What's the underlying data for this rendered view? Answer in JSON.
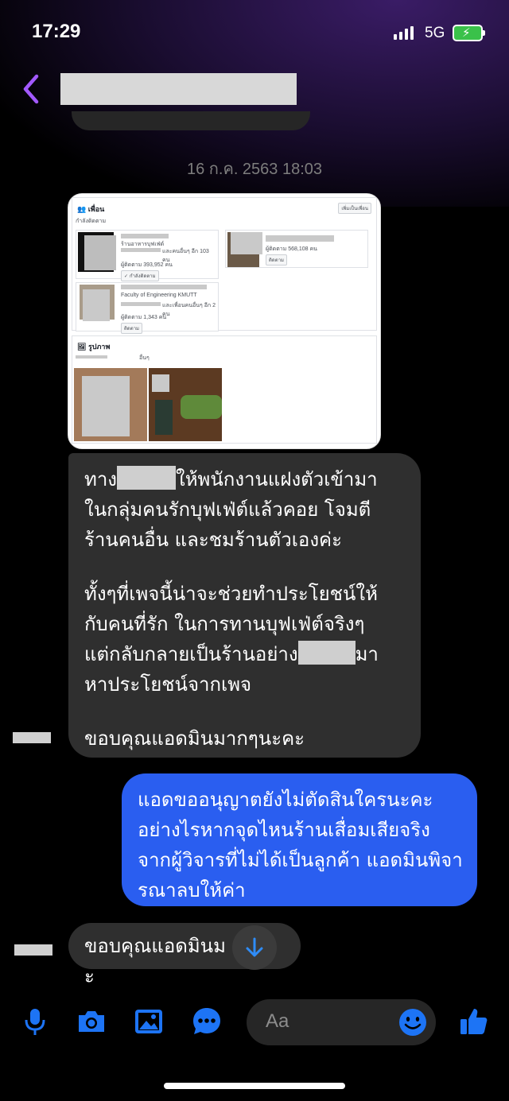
{
  "status_bar": {
    "time": "17:29",
    "network": "5G"
  },
  "header": {
    "contact_name": ""
  },
  "thread": {
    "timestamp": "16 ก.ค. 2563 18:03",
    "attachment": {
      "friends_title": "เพื่อน",
      "following_label": "กำลังติดตาม",
      "add_friend": "เพิ่มเป็นเพื่อน",
      "photos_title": "รูปภาพ",
      "follow_btn": "ติดตาม",
      "following_btn": "✓ กำลังติดตาม",
      "card2_line1": "Faculty of Engineering KMUTT",
      "card1_sub": "ร้านอาหารบุฟเฟ่ต์",
      "card1_mutual": "และคนอื่นๆ อีก 103 คน",
      "card1_followers": "ผู้ติดตาม 393,952 คน",
      "card3_followers": "ผู้ติดตาม 568,108 คน",
      "card2_mutual": "และเพื่อนคนอื่นๆ อีก 2 คน",
      "card2_followers": "ผู้ติดตาม 1,343 คน",
      "photos_other": "อื่นๆ"
    },
    "incoming_1": {
      "line1_a": "ทาง",
      "line1_b": "ให้พนักงานแฝงตัวเข้ามา",
      "line2": "ในกลุ่มคนรักบุฟเฟ่ต์แล้วคอย โจมตี",
      "line3": "ร้านคนอื่น และชมร้านตัวเองค่ะ",
      "line4": "ทั้งๆที่เพจนี้น่าจะช่วยทำประโยชน์ให้",
      "line5": "กับคนที่รัก ในการทานบุฟเฟ่ต์จริงๆ",
      "line6_a": "แต่กลับกลายเป็นร้านอย่าง",
      "line6_b": "มา",
      "line7": "หาประโยชน์จากเพจ",
      "line8": "ขอบคุณแอดมินมากๆนะคะ"
    },
    "outgoing_1": {
      "text": "แอดขออนุญาตยังไม่ตัดสินใครนะคะ อย่างไรหากจุดไหนร้านเสื่อมเสียจริง จากผู้วิจารที่ไม่ได้เป็นลูกค้า แอดมินพิจารณาลบให้ค่า"
    },
    "incoming_2": {
      "text": "ขอบคุณแอดมินม",
      "tail": "ะ"
    }
  },
  "composer": {
    "placeholder": "Aa"
  },
  "colors": {
    "accent": "#2a5ef0",
    "icon_blue": "#1d74f5",
    "back_purple": "#a259ff"
  }
}
